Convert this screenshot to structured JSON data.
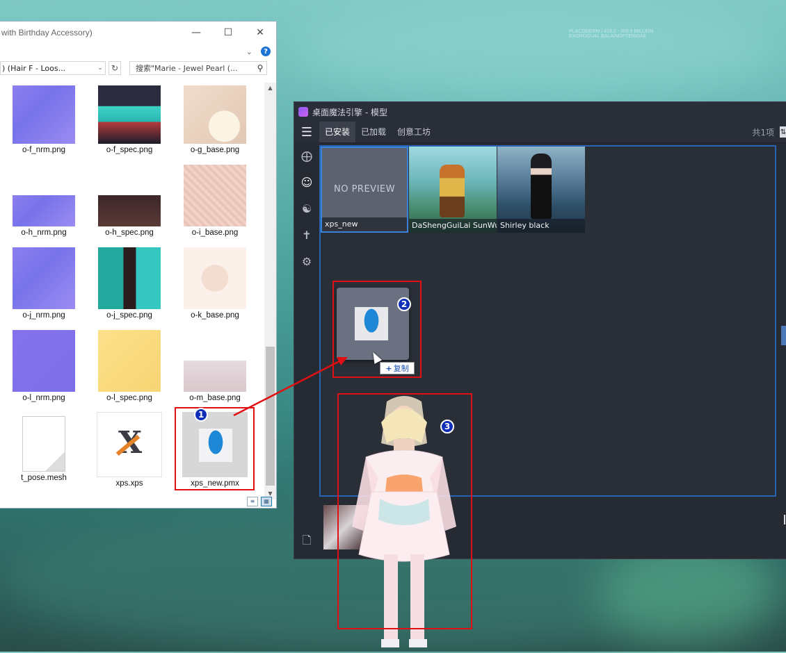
{
  "explorer": {
    "title": "with Birthday Accessory)",
    "address": ") (Hair F - Loos...",
    "search_placeholder": "搜索\"Marie - Jewel Pearl (...",
    "files": [
      {
        "name": "o-f_nrm.png",
        "kind": "nrm"
      },
      {
        "name": "o-f_spec.png",
        "kind": "spec"
      },
      {
        "name": "o-g_base.png",
        "kind": "base"
      },
      {
        "name": "o-h_nrm.png",
        "kind": "nrm"
      },
      {
        "name": "o-h_spec.png",
        "kind": "spec"
      },
      {
        "name": "o-i_base.png",
        "kind": "base"
      },
      {
        "name": "o-j_nrm.png",
        "kind": "nrm"
      },
      {
        "name": "o-j_spec.png",
        "kind": "spec"
      },
      {
        "name": "o-k_base.png",
        "kind": "base"
      },
      {
        "name": "o-l_nrm.png",
        "kind": "nrm"
      },
      {
        "name": "o-l_spec.png",
        "kind": "spec"
      },
      {
        "name": "o-m_base.png",
        "kind": "base"
      },
      {
        "name": "t_pose.mesh",
        "kind": "file"
      },
      {
        "name": "xps.xps",
        "kind": "xps"
      },
      {
        "name": "xps_new.pmx",
        "kind": "pmx"
      }
    ]
  },
  "app": {
    "title": "桌面魔法引擎 - 模型",
    "tabs": [
      "已安装",
      "已加载",
      "创意工坊"
    ],
    "active_tab": 0,
    "count_label": "共1项",
    "items": [
      {
        "name": "xps_new",
        "preview": "NO PREVIEW"
      },
      {
        "name": "DaShengGuiLai SunWu",
        "preview": ""
      },
      {
        "name": "Shirley black",
        "preview": ""
      }
    ]
  },
  "drag": {
    "copy_label": "复制",
    "copy_icon": "+"
  },
  "annotations": [
    "1",
    "2",
    "3"
  ],
  "colors": {
    "annotation_red": "#e10f14",
    "badge_blue": "#0f2fb8",
    "selection_blue": "#2964b3"
  }
}
